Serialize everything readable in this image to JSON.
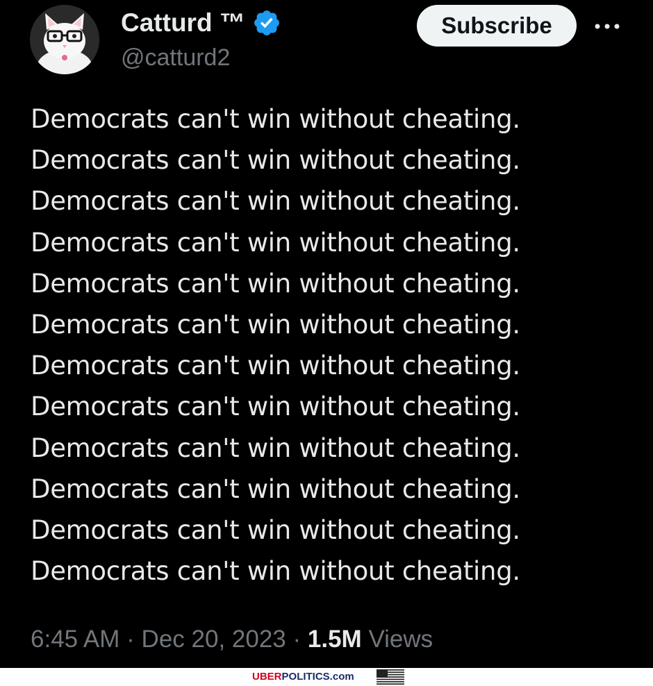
{
  "author": {
    "display_name": "Catturd ™",
    "handle": "@catturd2",
    "avatar_icon": "cat-with-glasses-avatar",
    "verified_icon": "verified-badge-icon",
    "verified_color": "#1d9bf0"
  },
  "actions": {
    "subscribe_label": "Subscribe",
    "more_icon": "more-horizontal-icon"
  },
  "tweet": {
    "lines": [
      "Democrats can't win without cheating.",
      "Democrats can't win without cheating.",
      "Democrats can't win without cheating.",
      "Democrats can't win without cheating.",
      "Democrats can't win without cheating.",
      "Democrats can't win without cheating.",
      "Democrats can't win without cheating.",
      "Democrats can't win without cheating.",
      "Democrats can't win without cheating.",
      "Democrats can't win without cheating.",
      "Democrats can't win without cheating.",
      "Democrats can't win without cheating."
    ]
  },
  "meta": {
    "time": "6:45 AM",
    "separator": "·",
    "date": "Dec 20, 2023",
    "views_count": "1.5M",
    "views_label": "Views"
  },
  "watermark": {
    "part1": "UBER",
    "part2": "POLITICS.com",
    "color1": "#d0021b",
    "color2": "#1a2a6c",
    "flag_icon": "us-flag-icon"
  },
  "colors": {
    "background": "#000000",
    "text_primary": "#e7e9ea",
    "text_secondary": "#71767b",
    "button_bg": "#eff3f4"
  }
}
